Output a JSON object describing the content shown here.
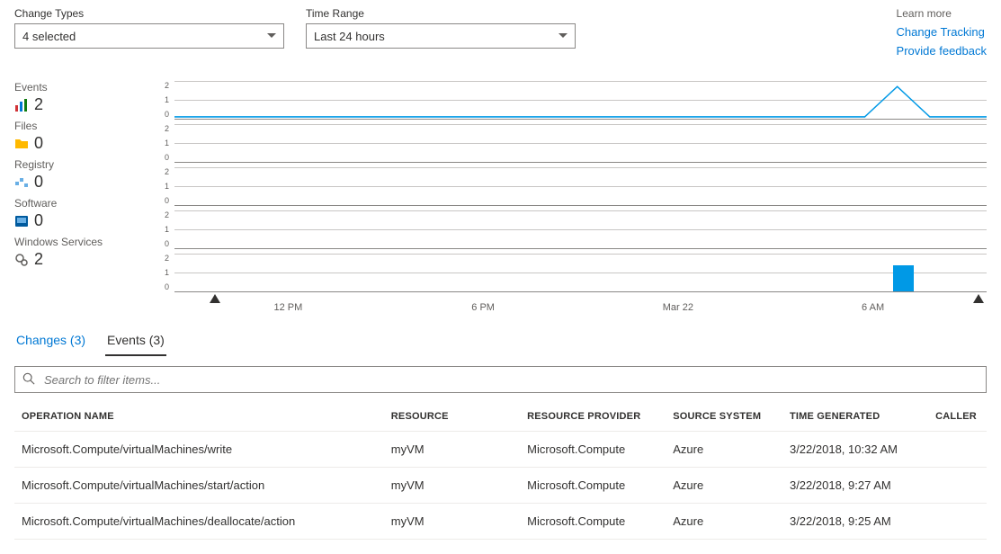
{
  "filters": {
    "changeTypes": {
      "label": "Change Types",
      "value": "4 selected"
    },
    "timeRange": {
      "label": "Time Range",
      "value": "Last 24 hours"
    }
  },
  "learnMore": {
    "title": "Learn more",
    "links": {
      "tracking": "Change Tracking",
      "feedback": "Provide feedback"
    }
  },
  "stats": {
    "events": {
      "label": "Events",
      "value": "2"
    },
    "files": {
      "label": "Files",
      "value": "0"
    },
    "registry": {
      "label": "Registry",
      "value": "0"
    },
    "software": {
      "label": "Software",
      "value": "0"
    },
    "services": {
      "label": "Windows Services",
      "value": "2"
    }
  },
  "chart_data": [
    {
      "name": "Events",
      "type": "line",
      "ylim": [
        0,
        2
      ],
      "yticks": [
        "2",
        "1",
        "0"
      ],
      "series": [
        {
          "name": "Events",
          "values_note": "≈0 across the range with a brief spike to ~2 near the end"
        }
      ]
    },
    {
      "name": "Files",
      "type": "line",
      "ylim": [
        0,
        2
      ],
      "yticks": [
        "2",
        "1",
        "0"
      ],
      "series": [
        {
          "name": "Files",
          "values_note": "flat 0"
        }
      ]
    },
    {
      "name": "Registry",
      "type": "line",
      "ylim": [
        0,
        2
      ],
      "yticks": [
        "2",
        "1",
        "0"
      ],
      "series": [
        {
          "name": "Registry",
          "values_note": "flat 0"
        }
      ]
    },
    {
      "name": "Software",
      "type": "line",
      "ylim": [
        0,
        2
      ],
      "yticks": [
        "2",
        "1",
        "0"
      ],
      "series": [
        {
          "name": "Software",
          "values_note": "flat 0"
        }
      ]
    },
    {
      "name": "Windows Services",
      "type": "bar",
      "ylim": [
        0,
        2
      ],
      "yticks": [
        "2",
        "1",
        "0"
      ],
      "series": [
        {
          "name": "Windows Services",
          "values_note": "one bar near end, height ≈1–2"
        }
      ]
    }
  ],
  "timeAxis": {
    "ticks": [
      "12 PM",
      "6 PM",
      "Mar 22",
      "6 AM"
    ]
  },
  "tabs": {
    "changes": "Changes (3)",
    "events": "Events (3)"
  },
  "search": {
    "placeholder": "Search to filter items..."
  },
  "table": {
    "headers": {
      "operation": "OPERATION NAME",
      "resource": "RESOURCE",
      "provider": "RESOURCE PROVIDER",
      "source": "SOURCE SYSTEM",
      "time": "TIME GENERATED",
      "caller": "CALLER"
    },
    "rows": [
      {
        "operation": "Microsoft.Compute/virtualMachines/write",
        "resource": "myVM",
        "provider": "Microsoft.Compute",
        "source": "Azure",
        "time": "3/22/2018, 10:32 AM",
        "caller": ""
      },
      {
        "operation": "Microsoft.Compute/virtualMachines/start/action",
        "resource": "myVM",
        "provider": "Microsoft.Compute",
        "source": "Azure",
        "time": "3/22/2018, 9:27 AM",
        "caller": ""
      },
      {
        "operation": "Microsoft.Compute/virtualMachines/deallocate/action",
        "resource": "myVM",
        "provider": "Microsoft.Compute",
        "source": "Azure",
        "time": "3/22/2018, 9:25 AM",
        "caller": ""
      }
    ]
  }
}
